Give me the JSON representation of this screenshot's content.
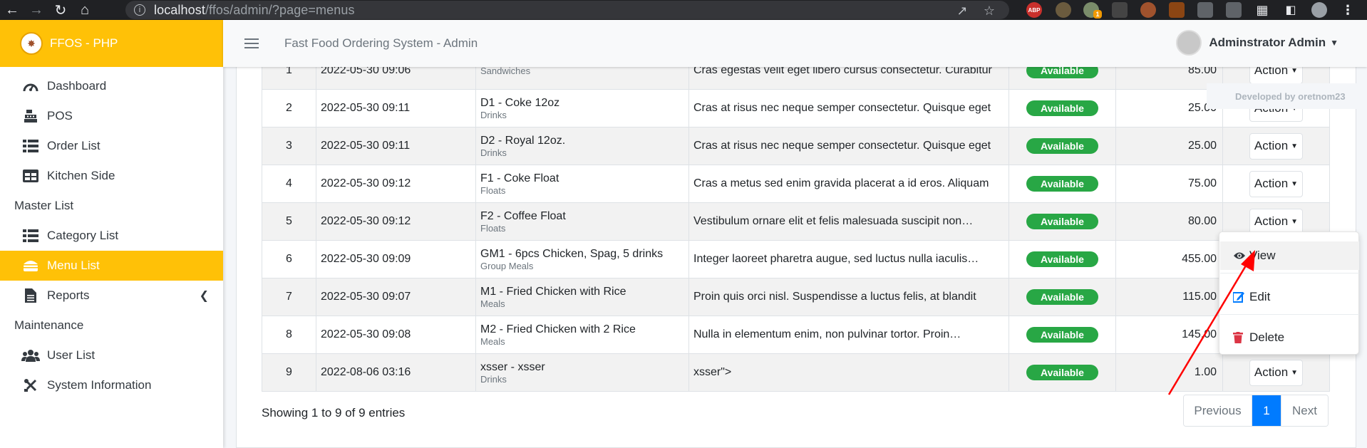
{
  "browser": {
    "url_host": "localhost",
    "url_path": "/ffos/admin/?page=menus",
    "ext_badge": "ABP",
    "ext_count": "1"
  },
  "sidebar": {
    "brand": "FFOS - PHP",
    "items": [
      {
        "label": "Dashboard",
        "icon": "dashboard-icon"
      },
      {
        "label": "POS",
        "icon": "cash-register-icon"
      },
      {
        "label": "Order List",
        "icon": "list-icon"
      },
      {
        "label": "Kitchen Side",
        "icon": "table-icon"
      }
    ],
    "section_master": "Master List",
    "master_items": [
      {
        "label": "Category List",
        "icon": "list-icon"
      },
      {
        "label": "Menu List",
        "icon": "hamburger-food-icon",
        "active": true
      },
      {
        "label": "Reports",
        "icon": "file-icon"
      }
    ],
    "section_maintenance": "Maintenance",
    "maintenance_items": [
      {
        "label": "User List",
        "icon": "users-icon"
      },
      {
        "label": "System Information",
        "icon": "tools-icon"
      }
    ]
  },
  "topnav": {
    "title": "Fast Food Ordering System - Admin",
    "user": "Adminstrator Admin"
  },
  "developer_credit": "Developed by oretnom23",
  "table": {
    "rows": [
      {
        "num": "1",
        "date": "2022-05-30 09:06",
        "menu": "",
        "category": "Sandwiches",
        "desc": "Cras egestas velit eget libero cursus consectetur. Curabitur",
        "status": "Available",
        "price": "85.00",
        "action": "Action"
      },
      {
        "num": "2",
        "date": "2022-05-30 09:11",
        "menu": "D1 - Coke 12oz",
        "category": "Drinks",
        "desc": "Cras at risus nec neque semper consectetur. Quisque eget",
        "status": "Available",
        "price": "25.00",
        "action": "Action"
      },
      {
        "num": "3",
        "date": "2022-05-30 09:11",
        "menu": "D2 - Royal 12oz.",
        "category": "Drinks",
        "desc": "Cras at risus nec neque semper consectetur. Quisque eget",
        "status": "Available",
        "price": "25.00",
        "action": "Action"
      },
      {
        "num": "4",
        "date": "2022-05-30 09:12",
        "menu": "F1 - Coke Float",
        "category": "Floats",
        "desc": "Cras a metus sed enim gravida placerat a id eros. Aliquam",
        "status": "Available",
        "price": "75.00",
        "action": "Action"
      },
      {
        "num": "5",
        "date": "2022-05-30 09:12",
        "menu": "F2 - Coffee Float",
        "category": "Floats",
        "desc": "Vestibulum ornare elit et felis malesuada suscipit non…",
        "status": "Available",
        "price": "80.00",
        "action": "Action"
      },
      {
        "num": "6",
        "date": "2022-05-30 09:09",
        "menu": "GM1 - 6pcs Chicken, Spag, 5 drinks",
        "category": "Group Meals",
        "desc": "Integer laoreet pharetra augue, sed luctus nulla iaculis…",
        "status": "Available",
        "price": "455.00",
        "action": ""
      },
      {
        "num": "7",
        "date": "2022-05-30 09:07",
        "menu": "M1 - Fried Chicken with Rice",
        "category": "Meals",
        "desc": "Proin quis orci nisl. Suspendisse a luctus felis, at blandit",
        "status": "Available",
        "price": "115.00",
        "action": ""
      },
      {
        "num": "8",
        "date": "2022-05-30 09:08",
        "menu": "M2 - Fried Chicken with 2 Rice",
        "category": "Meals",
        "desc": "Nulla in elementum enim, non pulvinar tortor. Proin…",
        "status": "Available",
        "price": "145.00",
        "action": ""
      },
      {
        "num": "9",
        "date": "2022-08-06 03:16",
        "menu": "xsser - xsser",
        "category": "Drinks",
        "desc": "xsser\">",
        "status": "Available",
        "price": "1.00",
        "action": "Action"
      }
    ]
  },
  "footer": {
    "showing": "Showing 1 to 9 of 9 entries",
    "prev": "Previous",
    "page": "1",
    "next": "Next"
  },
  "dropdown": {
    "view": "View",
    "edit": "Edit",
    "delete": "Delete"
  },
  "colors": {
    "brand": "#ffc107",
    "badge": "#28a745",
    "page_active": "#007bff",
    "annotation_arrow": "#ff0000",
    "delete_icon": "#dc3545",
    "edit_icon": "#007bff"
  }
}
